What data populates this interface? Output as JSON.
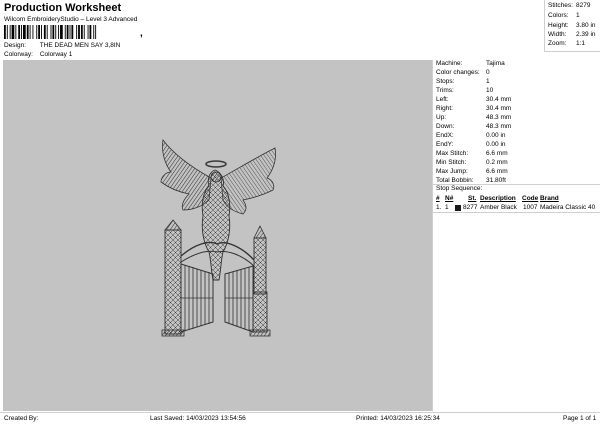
{
  "header": {
    "title": "Production Worksheet",
    "subtitle": "Wilcom EmbroideryStudio – Level 3 Advanced",
    "barcode_suffix": ",",
    "design_label": "Design:",
    "design_value": "THE DEAD MEN SAY 3,8IN",
    "colorway_label": "Colorway:",
    "colorway_value": "Colorway 1"
  },
  "stats": {
    "stitches_label": "Stitches:",
    "stitches_value": "8279",
    "colors_label": "Colors:",
    "colors_value": "1",
    "height_label": "Height:",
    "height_value": "3.80 in",
    "width_label": "Width:",
    "width_value": "2.39 in",
    "zoom_label": "Zoom:",
    "zoom_value": "1:1"
  },
  "info": {
    "machine_label": "Machine:",
    "machine_value": "Tajima",
    "color_changes_label": "Color changes:",
    "color_changes_value": "0",
    "stops_label": "Stops:",
    "stops_value": "1",
    "trims_label": "Trims:",
    "trims_value": "10",
    "left_label": "Left:",
    "left_value": "30.4 mm",
    "right_label": "Right:",
    "right_value": "30.4 mm",
    "up_label": "Up:",
    "up_value": "48.3 mm",
    "down_label": "Down:",
    "down_value": "48.3 mm",
    "endx_label": "EndX:",
    "endx_value": "0.00 in",
    "endy_label": "EndY:",
    "endy_value": "0.00 in",
    "max_stitch_label": "Max Stitch:",
    "max_stitch_value": "6.6 mm",
    "min_stitch_label": "Min Stitch:",
    "min_stitch_value": "0.2 mm",
    "max_jump_label": "Max Jump:",
    "max_jump_value": "6.6 mm",
    "total_bobbin_label": "Total Bobbin:",
    "total_bobbin_value": "31.80ft"
  },
  "stop_sequence": {
    "title": "Stop Sequence:",
    "headers": {
      "num": "#",
      "n": "N#",
      "st": "St.",
      "description": "Description",
      "code": "Code",
      "brand": "Brand"
    },
    "rows": [
      {
        "num": "1.",
        "n": "1",
        "swatch_color": "#1a1a1a",
        "st": "8277",
        "description": "Amber Black",
        "code": "1007",
        "brand": "Madeira Classic 40"
      }
    ]
  },
  "footer": {
    "created_by": "Created By:",
    "last_saved": "Last Saved: 14/03/2023 13:54:56",
    "printed": "Printed: 14/03/2023 16:25:34",
    "page": "Page 1 of 1"
  },
  "colors": {
    "preview_background": "#c3c3c3",
    "thread": "#3a3a3a"
  }
}
